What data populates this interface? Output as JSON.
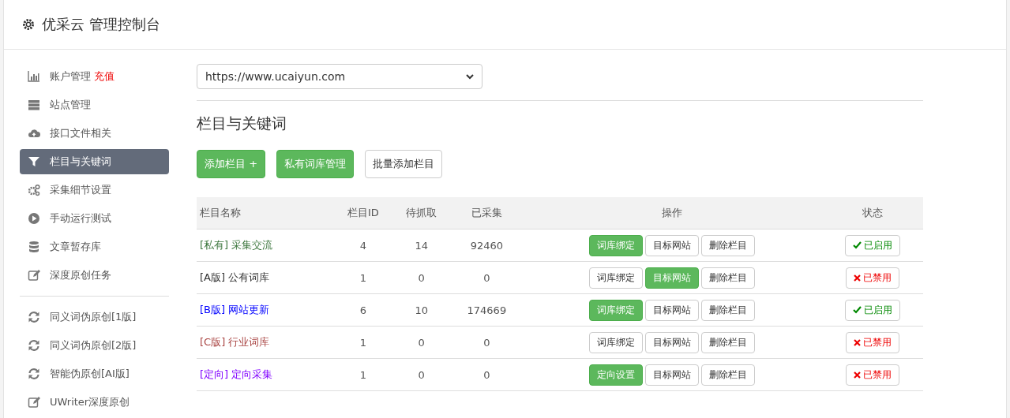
{
  "header": {
    "title": "优采云 管理控制台"
  },
  "sidebar": {
    "groups": [
      {
        "items": [
          {
            "kind": "chart",
            "label": "账户管理",
            "badge": "充值",
            "selected": false
          },
          {
            "kind": "server",
            "label": "站点管理",
            "selected": false
          },
          {
            "kind": "cloud",
            "label": "接口文件相关",
            "selected": false
          },
          {
            "kind": "filter",
            "label": "栏目与关键词",
            "selected": true
          },
          {
            "kind": "gears",
            "label": "采集细节设置",
            "selected": false
          },
          {
            "kind": "play",
            "label": "手动运行测试",
            "selected": false
          },
          {
            "kind": "database",
            "label": "文章暂存库",
            "selected": false
          },
          {
            "kind": "edit",
            "label": "深度原创任务",
            "selected": false
          }
        ]
      },
      {
        "items": [
          {
            "kind": "refresh",
            "label": "同义词伪原创[1版]",
            "selected": false
          },
          {
            "kind": "refresh",
            "label": "同义词伪原创[2版]",
            "selected": false
          },
          {
            "kind": "refresh",
            "label": "智能伪原创[AI版]",
            "selected": false
          },
          {
            "kind": "edit",
            "label": "UWriter深度原创",
            "selected": false
          }
        ]
      }
    ]
  },
  "site_select": {
    "value": "https://www.ucaiyun.com"
  },
  "section_title": "栏目与关键词",
  "toolbar": [
    {
      "label": "添加栏目 +",
      "kind": "primary"
    },
    {
      "label": "私有词库管理",
      "kind": "primary"
    },
    {
      "label": "批量添加栏目",
      "kind": "default"
    }
  ],
  "table": {
    "columns": [
      "栏目名称",
      "栏目ID",
      "待抓取",
      "已采集",
      "操作",
      "状态"
    ],
    "rows": [
      {
        "name": "[私有] 采集交流",
        "color": "#3c763d",
        "id": "4",
        "pending": "14",
        "collected": "92460",
        "actions": [
          {
            "label": "词库绑定",
            "kind": "primary"
          },
          {
            "label": "目标网站",
            "kind": "default"
          },
          {
            "label": "删除栏目",
            "kind": "default"
          }
        ],
        "status": "已启用",
        "enabled": true
      },
      {
        "name": "[A版] 公有词库",
        "color": "#333333",
        "id": "1",
        "pending": "0",
        "collected": "0",
        "actions": [
          {
            "label": "词库绑定",
            "kind": "default"
          },
          {
            "label": "目标网站",
            "kind": "primary"
          },
          {
            "label": "删除栏目",
            "kind": "default"
          }
        ],
        "status": "已禁用",
        "enabled": false
      },
      {
        "name": "[B版] 网站更新",
        "color": "#0000ff",
        "id": "6",
        "pending": "10",
        "collected": "174669",
        "actions": [
          {
            "label": "词库绑定",
            "kind": "primary"
          },
          {
            "label": "目标网站",
            "kind": "default"
          },
          {
            "label": "删除栏目",
            "kind": "default"
          }
        ],
        "status": "已启用",
        "enabled": true
      },
      {
        "name": "[C版] 行业词库",
        "color": "#a94442",
        "id": "1",
        "pending": "0",
        "collected": "0",
        "actions": [
          {
            "label": "词库绑定",
            "kind": "default"
          },
          {
            "label": "目标网站",
            "kind": "default"
          },
          {
            "label": "删除栏目",
            "kind": "default"
          }
        ],
        "status": "已禁用",
        "enabled": false
      },
      {
        "name": "[定向] 定向采集",
        "color": "#8000ff",
        "id": "1",
        "pending": "0",
        "collected": "0",
        "actions": [
          {
            "label": "定向设置",
            "kind": "primary"
          },
          {
            "label": "目标网站",
            "kind": "default"
          },
          {
            "label": "删除栏目",
            "kind": "default"
          }
        ],
        "status": "已禁用",
        "enabled": false
      }
    ]
  }
}
